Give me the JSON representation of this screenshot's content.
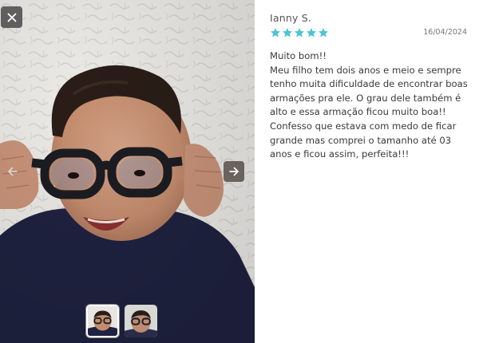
{
  "review": {
    "reviewer_name": "Ianny S.",
    "rating": 5,
    "rating_max": 5,
    "date": "16/04/2024",
    "title": "Muito bom!!",
    "text": "Meu filho tem dois anos e meio e sempre tenho muita dificuldade de encontrar boas armações pra ele. O grau dele também é alto e essa armação ficou muito boa!! Confesso que estava com medo de ficar grande mas comprei o tamanho até 03 anos e ficou assim, perfeita!!!"
  },
  "gallery": {
    "current_index": 1,
    "thumbnail_count": 2
  },
  "icons": {
    "close": "close-icon",
    "prev": "arrow-left-icon",
    "next": "arrow-right-icon",
    "star": "star-icon"
  },
  "colors": {
    "star": "#4cc3d6",
    "close_bg": "#5f5f5f",
    "text": "#3a3a3a"
  }
}
